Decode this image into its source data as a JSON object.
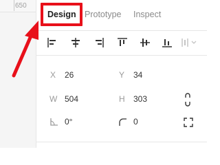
{
  "ruler": {
    "label": "650"
  },
  "tabs": [
    {
      "label": "Design",
      "active": true
    },
    {
      "label": "Prototype",
      "active": false
    },
    {
      "label": "Inspect",
      "active": false
    }
  ],
  "align_tools": [
    {
      "icon": "align-left-icon"
    },
    {
      "icon": "align-horizontal-center-icon"
    },
    {
      "icon": "align-right-icon"
    },
    {
      "icon": "align-top-icon"
    },
    {
      "icon": "align-vertical-center-icon"
    },
    {
      "icon": "align-bottom-icon"
    },
    {
      "icon": "distribute-spacing-icon"
    }
  ],
  "position": {
    "x_label": "X",
    "x": "26",
    "y_label": "Y",
    "y": "34"
  },
  "size": {
    "w_label": "W",
    "w": "504",
    "h_label": "H",
    "h": "303"
  },
  "rotation": {
    "value": "0°",
    "icon": "rotation-icon"
  },
  "corner_radius": {
    "value": "0",
    "icon": "corner-radius-icon"
  },
  "icons": {
    "constrain_proportions": "link-proportions-icon",
    "independent_corners": "independent-corners-icon"
  },
  "colors": {
    "highlight": "#e8101a",
    "arrow": "#e8101a",
    "muted_text": "#9a9a9a"
  }
}
